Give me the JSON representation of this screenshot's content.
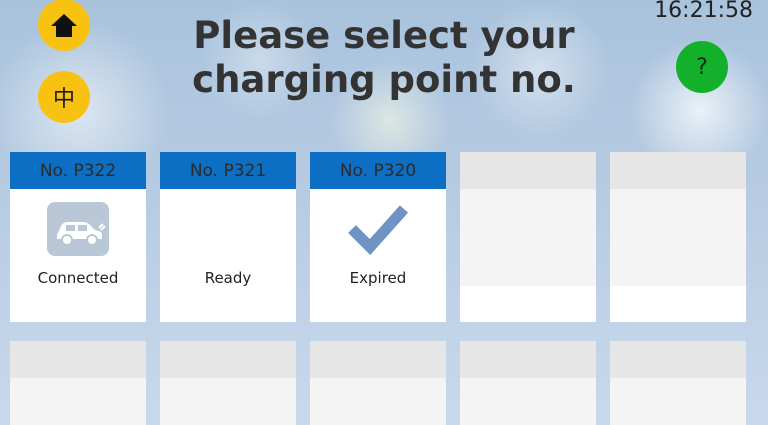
{
  "header": {
    "title_line1": "Please select your",
    "title_line2": "charging point no.",
    "clock": "16:21:58",
    "language_label": "中",
    "help_label": "?"
  },
  "colors": {
    "accent_yellow": "#f7c211",
    "help_green": "#13b12b",
    "header_blue": "#0d6fc4"
  },
  "charging_points": [
    {
      "label": "No. P322",
      "status": "Connected",
      "icon": "ev-connected-icon"
    },
    {
      "label": "No. P321",
      "status": "Ready",
      "icon": null
    },
    {
      "label": "No. P320",
      "status": "Expired",
      "icon": "checkmark-icon"
    }
  ]
}
